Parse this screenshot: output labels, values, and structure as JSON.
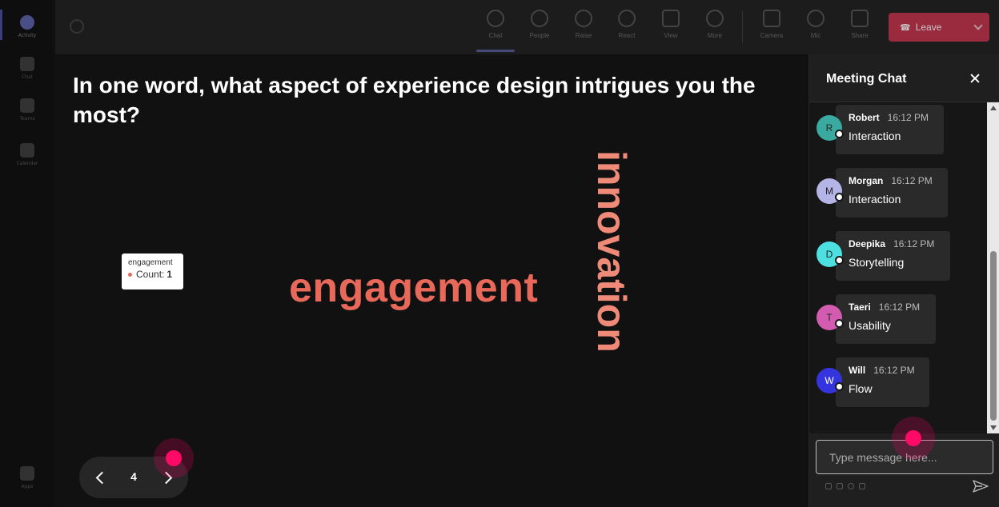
{
  "rail": {
    "items": [
      {
        "label": "Activity"
      },
      {
        "label": "Chat"
      },
      {
        "label": "Teams"
      },
      {
        "label": "Calendar"
      },
      {
        "label": "Apps"
      }
    ]
  },
  "toolbar": {
    "buttons": [
      {
        "label": "Chat"
      },
      {
        "label": "People"
      },
      {
        "label": "Raise"
      },
      {
        "label": "React"
      },
      {
        "label": "View"
      },
      {
        "label": "More"
      },
      {
        "label": "Camera"
      },
      {
        "label": "Mic"
      },
      {
        "label": "Share"
      }
    ],
    "leave_label": "Leave"
  },
  "stage": {
    "question": "In one word, what aspect of experience design intrigues you the most?",
    "words": {
      "horizontal": "engagement",
      "vertical": "innovation"
    },
    "tooltip": {
      "title": "engagement",
      "label": "Count:",
      "value": "1"
    },
    "pager": {
      "page": "4"
    }
  },
  "chat": {
    "title": "Meeting Chat",
    "messages": [
      {
        "initial": "R",
        "name": "Robert",
        "time": "16:12 PM",
        "text": "Interaction",
        "color": "#3aa99f"
      },
      {
        "initial": "M",
        "name": "Morgan",
        "time": "16:12 PM",
        "text": "Interaction",
        "color": "#b4b4e6"
      },
      {
        "initial": "D",
        "name": "Deepika",
        "time": "16:12 PM",
        "text": "Storytelling",
        "color": "#4de0e0"
      },
      {
        "initial": "T",
        "name": "Taeri",
        "time": "16:12 PM",
        "text": "Usability",
        "color": "#d45cb0"
      },
      {
        "initial": "W",
        "name": "Will",
        "time": "16:12 PM",
        "text": "Flow",
        "color": "#3535e0"
      }
    ],
    "input_placeholder": "Type message here..."
  },
  "colors": {
    "accent": "#ff0a66",
    "word_primary": "#e8685a",
    "word_secondary": "#f08a78"
  }
}
